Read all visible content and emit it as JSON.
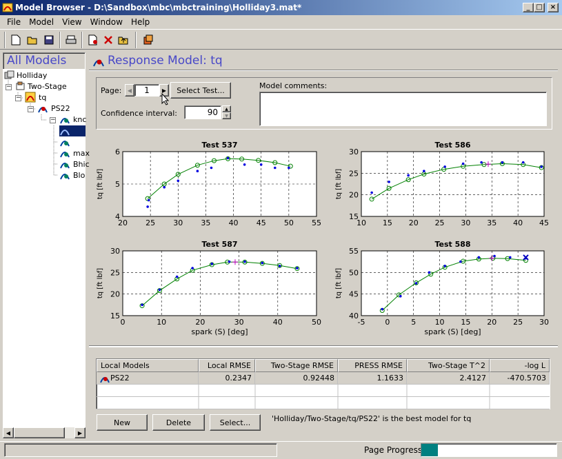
{
  "window": {
    "title": "Model Browser - D:\\Sandbox\\mbc\\mbctraining\\Holliday3.mat*"
  },
  "menu": [
    "File",
    "Model",
    "View",
    "Window",
    "Help"
  ],
  "tree": {
    "header": "All Models",
    "nodes": [
      "Holliday",
      "Two-Stage",
      "tq",
      "PS22",
      "knc",
      "max",
      "Bhic",
      "Blo"
    ]
  },
  "main": {
    "title": "Response Model: tq",
    "page_label": "Page:",
    "page_value": "1",
    "select_test": "Select Test...",
    "confidence_label": "Confidence interval:",
    "confidence_value": "90",
    "comments_label": "Model comments:",
    "comments_value": ""
  },
  "chart_data": [
    {
      "type": "scatter",
      "title": "Test 537",
      "ylabel": "tq [ft lbf]",
      "xlabel": "",
      "xlim": [
        20,
        55
      ],
      "ylim": [
        4,
        6
      ],
      "xticks": [
        20,
        25,
        30,
        35,
        40,
        45,
        50,
        55
      ],
      "yticks": [
        4,
        5,
        6
      ],
      "grid": true,
      "points_x": [
        24.5,
        24.7,
        27.5,
        30,
        33.5,
        36,
        39,
        42,
        45,
        47.5,
        50
      ],
      "points_y": [
        4.3,
        4.5,
        4.9,
        5.1,
        5.4,
        5.5,
        5.8,
        5.6,
        5.6,
        5.5,
        5.5
      ],
      "fit_x": [
        24.5,
        27.5,
        30,
        33.5,
        36.5,
        39,
        41.5,
        44.5,
        47.5,
        50.3
      ],
      "fit_y": [
        4.55,
        5.0,
        5.3,
        5.58,
        5.72,
        5.78,
        5.77,
        5.73,
        5.66,
        5.55
      ],
      "best_x": null,
      "best_y": null
    },
    {
      "type": "scatter",
      "title": "Test 586",
      "ylabel": "tq [ft lbf]",
      "xlabel": "",
      "xlim": [
        10,
        45
      ],
      "ylim": [
        15,
        30
      ],
      "xticks": [
        10,
        15,
        20,
        25,
        30,
        35,
        40,
        45
      ],
      "yticks": [
        15,
        20,
        25,
        30
      ],
      "grid": true,
      "points_x": [
        12,
        15.3,
        19,
        22,
        26,
        29.5,
        33,
        37,
        41,
        44.5
      ],
      "points_y": [
        20.5,
        23,
        24.5,
        25.5,
        26.5,
        27.2,
        27.5,
        27.5,
        27.5,
        26.5
      ],
      "fit_x": [
        12,
        15.3,
        19,
        22,
        25.8,
        29.5,
        33.5,
        37,
        41,
        44.5
      ],
      "fit_y": [
        19,
        21.5,
        23.5,
        24.8,
        25.9,
        26.6,
        27,
        27.2,
        27,
        26.3
      ],
      "best_x": 34.3,
      "best_y": 27.1
    },
    {
      "type": "scatter",
      "title": "Test 587",
      "ylabel": "tq [ft lbf]",
      "xlabel": "spark (S) [deg]",
      "xlim": [
        0,
        50
      ],
      "ylim": [
        15,
        30
      ],
      "xticks": [
        0,
        10,
        20,
        30,
        40,
        50
      ],
      "yticks": [
        15,
        20,
        25,
        30
      ],
      "grid": true,
      "points_x": [
        5,
        9.5,
        14,
        18,
        23,
        27.5,
        31.5,
        36,
        40.5,
        45
      ],
      "points_y": [
        17.5,
        21,
        24,
        26,
        27,
        27.5,
        27.5,
        27.2,
        26.5,
        26
      ],
      "fit_x": [
        5,
        9.5,
        14,
        18,
        23,
        27,
        31.5,
        36,
        40.5,
        45
      ],
      "fit_y": [
        17.3,
        20.8,
        23.5,
        25.5,
        26.8,
        27.4,
        27.4,
        27.1,
        26.6,
        25.9
      ],
      "best_x": 29,
      "best_y": 27.4
    },
    {
      "type": "scatter",
      "title": "Test 588",
      "ylabel": "tq [ft lbf]",
      "xlabel": "spark (S) [deg]",
      "xlim": [
        -5,
        30
      ],
      "ylim": [
        40,
        55
      ],
      "xticks": [
        -5,
        0,
        5,
        10,
        15,
        20,
        25,
        30
      ],
      "yticks": [
        40,
        45,
        50,
        55
      ],
      "grid": true,
      "points_x": [
        -1,
        2.5,
        5.5,
        8,
        11,
        14,
        17.5,
        20.5,
        23.5,
        26.5
      ],
      "points_y": [
        41.5,
        44.5,
        47.5,
        50,
        51.5,
        52.5,
        53.5,
        53.8,
        53.5,
        53.3
      ],
      "fit_x": [
        -1,
        2.2,
        5.5,
        8.3,
        11,
        14.5,
        17.5,
        20.2,
        23,
        26.5
      ],
      "fit_y": [
        41.2,
        44.8,
        47.6,
        49.6,
        51.2,
        52.6,
        53.1,
        53.3,
        53.2,
        52.8
      ],
      "best_x": 20,
      "best_y": 53.3,
      "cross_x": 26.5,
      "cross_y": 53.5
    }
  ],
  "local_models": {
    "columns": [
      "Local Models",
      "Local RMSE",
      "Two-Stage RMSE",
      "PRESS RMSE",
      "Two-Stage T^2",
      "-log L"
    ],
    "rows": [
      [
        "PS22",
        "0.2347",
        "0.92448",
        "1.1633",
        "2.4127",
        "-470.5703"
      ]
    ]
  },
  "buttons": {
    "new": "New",
    "delete": "Delete",
    "select": "Select..."
  },
  "best_model_text": "'Holliday/Two-Stage/tq/PS22' is the best model for tq",
  "status": {
    "progress_label": "Page Progress:",
    "progress_fraction": 0.12
  },
  "colors": {
    "accent": "#4848c8",
    "progress": "#008080",
    "titlebar": "#0a246a"
  }
}
